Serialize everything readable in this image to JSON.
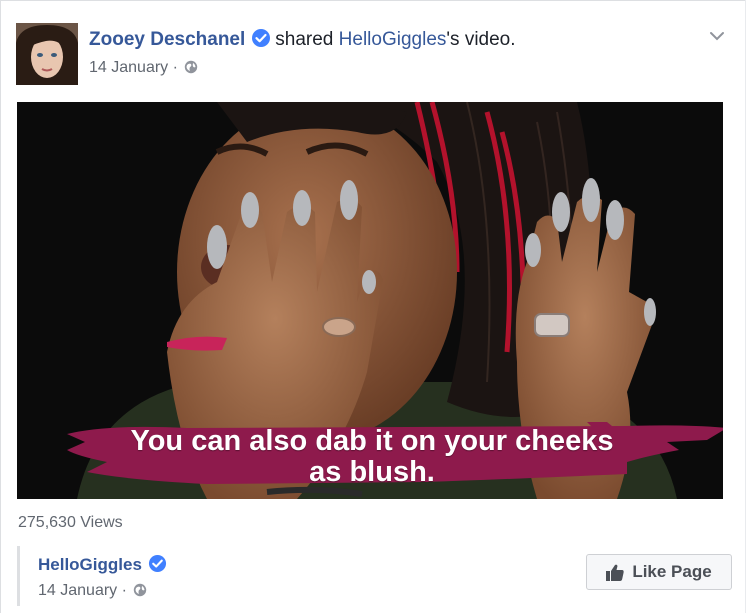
{
  "post": {
    "author": "Zooey Deschanel",
    "action": "shared",
    "shared_page": "HelloGiggles",
    "shared_suffix": "'s video.",
    "date": "14 January",
    "separator": "·"
  },
  "video": {
    "caption_line1": "You can also dab it on your cheeks",
    "caption_line2": "as blush."
  },
  "views": "275,630 Views",
  "attribution": {
    "page_name": "HelloGiggles",
    "date": "14 January",
    "separator": "·",
    "like_label": "Like Page"
  },
  "colors": {
    "link": "#365899",
    "verified": "#4080ff",
    "caption_brush": "#8e1a4c"
  },
  "icons": [
    "verified-badge-icon",
    "globe-icon",
    "chevron-down-icon",
    "thumbs-up-icon"
  ]
}
